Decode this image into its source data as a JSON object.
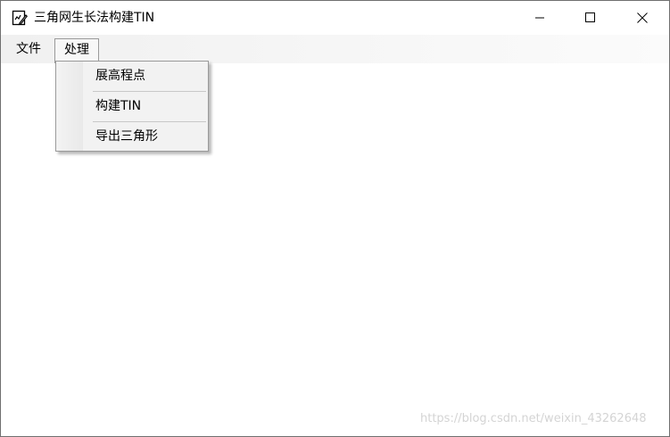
{
  "window": {
    "title": "三角网生长法构建TIN",
    "icons": {
      "app": "edit-document-icon",
      "minimize": "minimize-icon",
      "maximize": "maximize-icon",
      "close": "close-icon"
    }
  },
  "menubar": {
    "items": [
      {
        "label": "文件"
      },
      {
        "label": "处理"
      }
    ]
  },
  "dropdown": {
    "items": [
      {
        "label": "展高程点"
      },
      {
        "label": "构建TIN"
      },
      {
        "label": "导出三角形"
      }
    ]
  },
  "watermark": "https://blog.csdn.net/weixin_43262648",
  "colors": {
    "menubar_bg": "#f0f0f0",
    "dropdown_bg": "#f2f2f2",
    "border": "#9a9a9a"
  }
}
